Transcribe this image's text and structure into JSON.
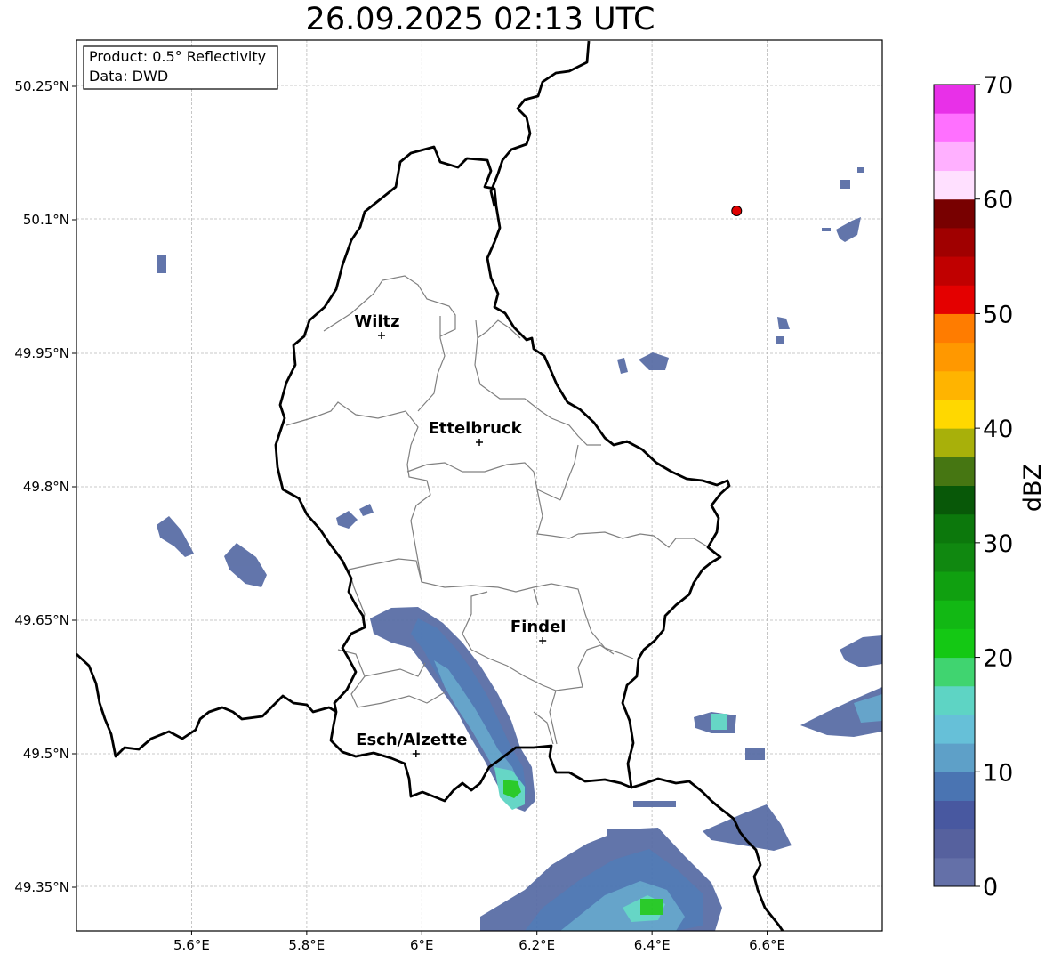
{
  "title": "26.09.2025 02:13 UTC",
  "info_box": {
    "product": "Product: 0.5° Reflectivity",
    "data": "Data: DWD"
  },
  "axes": {
    "lon_range": [
      5.4,
      6.8
    ],
    "lat_range": [
      49.3,
      50.3
    ],
    "x_ticks": [
      "5.6°E",
      "5.8°E",
      "6°E",
      "6.2°E",
      "6.4°E",
      "6.6°E"
    ],
    "x_tick_values": [
      5.6,
      5.8,
      6.0,
      6.2,
      6.4,
      6.6
    ],
    "y_ticks": [
      "50.25°N",
      "50.1°N",
      "49.95°N",
      "49.8°N",
      "49.65°N",
      "49.5°N",
      "49.35°N"
    ],
    "y_tick_values": [
      50.25,
      50.1,
      49.95,
      49.8,
      49.65,
      49.5,
      49.35
    ],
    "grid": true
  },
  "cities": [
    {
      "name": "Wiltz",
      "lon": 5.93,
      "lat": 49.97
    },
    {
      "name": "Ettelbruck",
      "lon": 6.1,
      "lat": 49.85
    },
    {
      "name": "Findel",
      "lon": 6.21,
      "lat": 49.627
    },
    {
      "name": "Esch/Alzette",
      "lon": 5.99,
      "lat": 49.5
    }
  ],
  "radar_site": {
    "lon": 6.547,
    "lat": 50.11,
    "color": "#e00000"
  },
  "colorbar": {
    "label": "dBZ",
    "min": 0,
    "max": 70,
    "step": 2.5,
    "tick_labels": [
      "0",
      "10",
      "20",
      "30",
      "40",
      "50",
      "60",
      "70"
    ],
    "colors": [
      "#6470a8",
      "#56619e",
      "#4858a0",
      "#4a74b2",
      "#5ea0c8",
      "#66c0d8",
      "#5ed4c4",
      "#40d470",
      "#14c814",
      "#12b814",
      "#10a010",
      "#108810",
      "#0c780c",
      "#085808",
      "#467612",
      "#a8b00a",
      "#ffd800",
      "#ffb400",
      "#ff9800",
      "#ff7c00",
      "#e40000",
      "#c00000",
      "#a00000",
      "#780000",
      "#ffe0ff",
      "#ffb0ff",
      "#ff70ff",
      "#e830e8"
    ]
  },
  "echo_colors": {
    "weak": "#5a6ea6",
    "mid": "#4a74b2",
    "light": "#5ea0c8",
    "cyan": "#5ed4c4",
    "green": "#20c820"
  }
}
